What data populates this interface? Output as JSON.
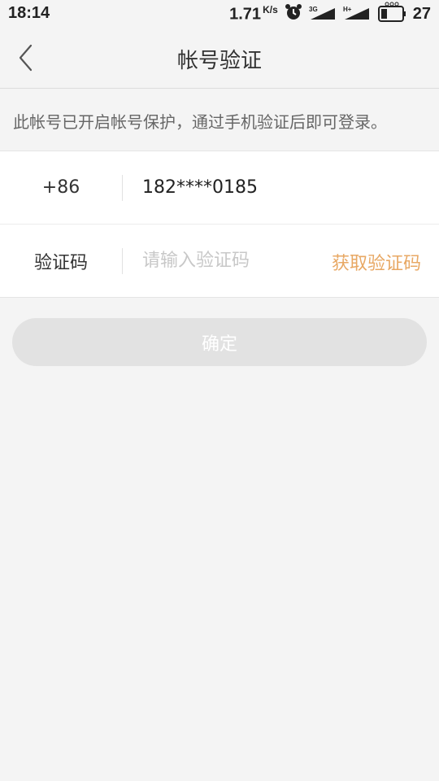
{
  "status_bar": {
    "time": "18:14",
    "network_speed": "1.71",
    "speed_unit": "K/s",
    "signal_1_label": "3G",
    "signal_2_label": "H+",
    "battery_level": "27"
  },
  "header": {
    "title": "帐号验证"
  },
  "notice": "此帐号已开启帐号保护，通过手机验证后即可登录。",
  "form": {
    "country_code": "+86",
    "phone_number": "182****0185",
    "code_label": "验证码",
    "code_placeholder": "请输入验证码",
    "code_value": "",
    "get_code_label": "获取验证码"
  },
  "confirm_label": "确定",
  "colors": {
    "accent": "#e8a864",
    "disabled_button": "#e2e2e2",
    "background": "#f4f4f4"
  }
}
